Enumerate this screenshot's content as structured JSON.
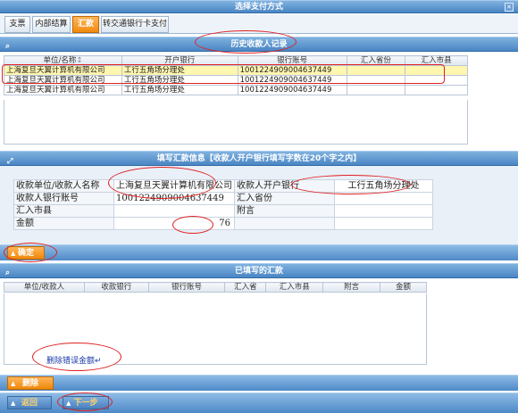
{
  "window": {
    "title": "选择支付方式",
    "close_glyph": "✕"
  },
  "tabs": [
    {
      "label": "支票",
      "active": false
    },
    {
      "label": "内部结算",
      "active": false
    },
    {
      "label": "汇款",
      "active": true
    },
    {
      "label": "转交通银行卡支付",
      "active": false
    }
  ],
  "history": {
    "title": "历史收款人记录",
    "columns": [
      "单位/名称",
      "开户银行",
      "银行账号",
      "汇入省份",
      "汇入市县"
    ],
    "sort_glyph": "↕",
    "rows": [
      {
        "name": "上海复旦天翼计算机有限公司",
        "bank": "工行五角场分理处",
        "account": "1001224909004637449",
        "province": "",
        "city": ""
      },
      {
        "name": "上海复旦天翼计算机有限公司",
        "bank": "工行五角场分理处",
        "account": "1001224909004637449",
        "province": "",
        "city": ""
      },
      {
        "name": "上海复旦天翼计算机有限公司",
        "bank": "工行五角场分理处",
        "account": "1001224909004637449",
        "province": "",
        "city": ""
      }
    ]
  },
  "form": {
    "title": "填写汇款信息【收款人开户银行填写字数在20个字之内】",
    "payee_name_label": "收款单位/收款人名称",
    "payee_name_value": "上海复旦天翼计算机有限公司",
    "payee_bank_label": "收款人开户银行",
    "payee_bank_value": "工行五角场分理处",
    "account_label": "收款人银行账号",
    "account_value": "1001224909004637449",
    "province_label": "汇入省份",
    "province_value": "",
    "city_label": "汇入市县",
    "city_value": "",
    "remark_label": "附言",
    "remark_value": "",
    "amount_label": "金额",
    "amount_value": "76",
    "confirm_label": "确定"
  },
  "filled": {
    "title": "已填写的汇款",
    "columns": [
      "单位/收款人",
      "收款银行",
      "银行账号",
      "汇入省",
      "汇入市县",
      "附言",
      "金额"
    ]
  },
  "note": {
    "text": "删除错误金额↵"
  },
  "buttons": {
    "delete_label": "删除",
    "back_label": "返回",
    "next_label": "下一步"
  },
  "colors": {
    "accent_orange": "#f18a10",
    "header_blue": "#4a86c4",
    "annotation_red": "#e02020"
  }
}
